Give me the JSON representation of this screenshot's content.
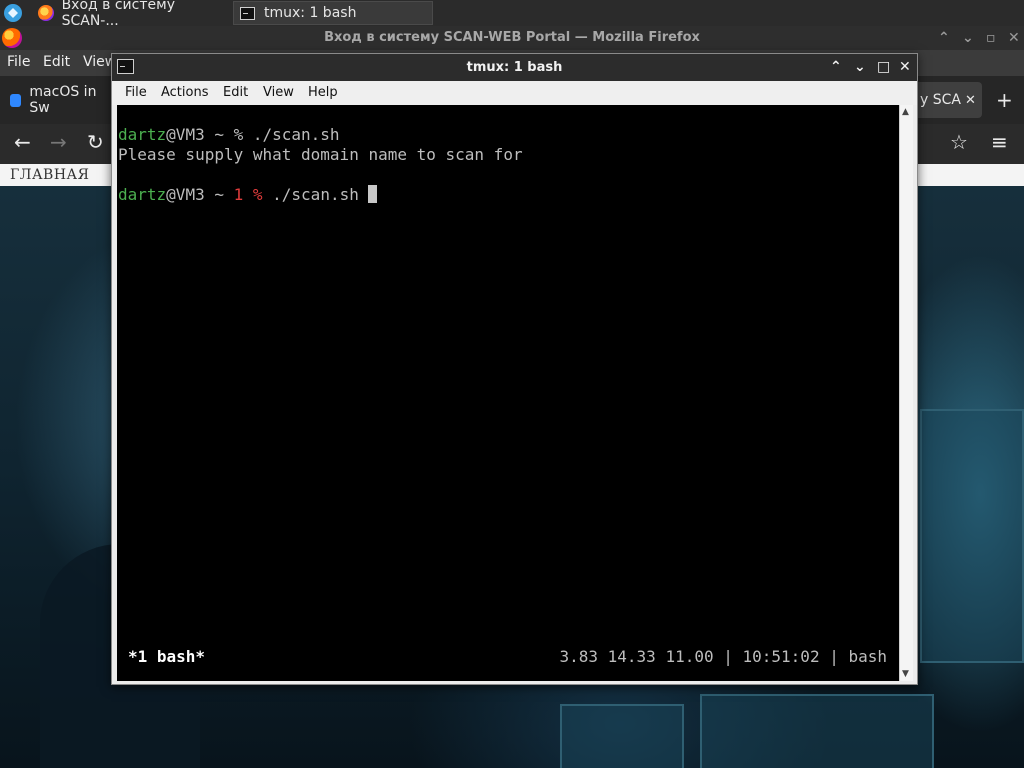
{
  "taskbar": {
    "tasks": [
      {
        "label": "Вход в систему SCAN-..."
      },
      {
        "label": "tmux: 1 bash"
      }
    ]
  },
  "firefox": {
    "title": "Вход в систему SCAN-WEB Portal — Mozilla Firefox",
    "menu": [
      "File",
      "Edit",
      "View"
    ],
    "tabs": [
      {
        "label": "macOS in Sw"
      },
      {
        "label": "y SCA"
      }
    ],
    "page_nav": "ГЛАВНАЯ"
  },
  "terminal": {
    "title": "tmux: 1 bash",
    "menu": [
      "File",
      "Actions",
      "Edit",
      "View",
      "Help"
    ],
    "lines": {
      "l1_user": "dartz",
      "l1_rest": "@VM3 ~ % ./scan.sh",
      "l2": "Please supply what domain name to scan for",
      "l3_user": "dartz",
      "l3_host": "@VM3 ~ ",
      "l3_code": "1 %",
      "l3_cmd": " ./scan.sh "
    },
    "status_left": "*1 bash*",
    "status_right": "3.83 14.33 11.00 | 10:51:02 | bash"
  }
}
